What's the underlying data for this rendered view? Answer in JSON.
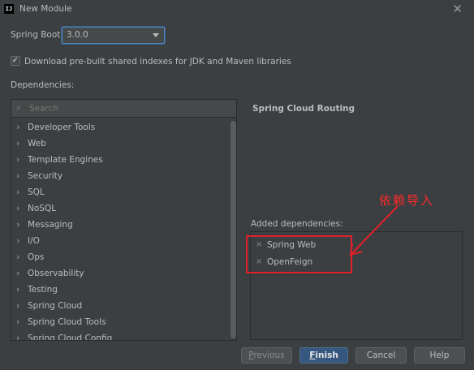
{
  "window": {
    "title": "New Module",
    "icon_label": "IJ",
    "close_glyph": "✕"
  },
  "spring_boot": {
    "label": "Spring Boot:",
    "selected": "3.0.0"
  },
  "download_indexes": {
    "checked": true,
    "check_glyph": "✓",
    "label": "Download pre-built shared indexes for JDK and Maven libraries"
  },
  "dependencies": {
    "label": "Dependencies:",
    "search_placeholder": "Search",
    "search_icon_glyph": "⌕",
    "chevron_glyph": "›",
    "categories": [
      {
        "label": "Developer Tools"
      },
      {
        "label": "Web"
      },
      {
        "label": "Template Engines"
      },
      {
        "label": "Security"
      },
      {
        "label": "SQL"
      },
      {
        "label": "NoSQL"
      },
      {
        "label": "Messaging"
      },
      {
        "label": "I/O"
      },
      {
        "label": "Ops"
      },
      {
        "label": "Observability"
      },
      {
        "label": "Testing"
      },
      {
        "label": "Spring Cloud"
      },
      {
        "label": "Spring Cloud Tools"
      },
      {
        "label": "Spring Cloud Config"
      }
    ]
  },
  "detail": {
    "title": "Spring Cloud Routing"
  },
  "added": {
    "label": "Added dependencies:",
    "remove_glyph": "×",
    "items": [
      {
        "label": "Spring Web"
      },
      {
        "label": "OpenFeign"
      }
    ]
  },
  "annotation": {
    "text": "依赖导入",
    "color": "#e0202a"
  },
  "buttons": {
    "previous_mnemonic": "P",
    "previous_rest": "revious",
    "finish_mnemonic": "F",
    "finish_rest": "inish",
    "cancel": "Cancel",
    "help": "Help"
  },
  "colors": {
    "background": "#3c3f41",
    "accent": "#365880",
    "focus_border": "#4a88c7",
    "text": "#bbbbbb"
  }
}
